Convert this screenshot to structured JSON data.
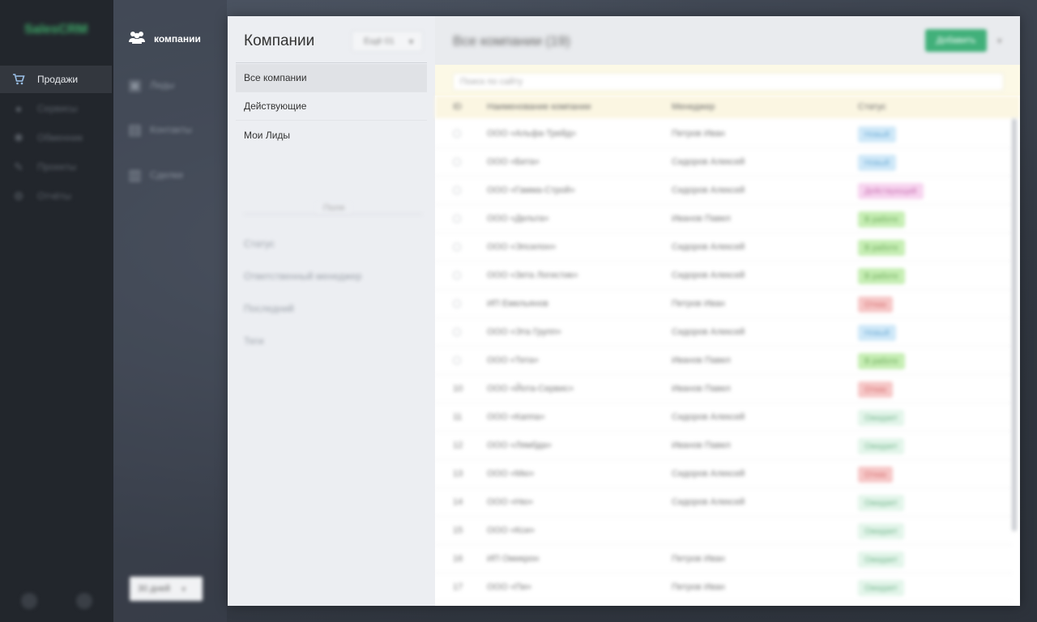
{
  "app": {
    "logo": "SalesCRM"
  },
  "main_nav": {
    "items": [
      {
        "label": "Продажи",
        "icon": "cart-icon",
        "active": true
      },
      {
        "label": "Сервисы",
        "icon": "plus-circle-icon",
        "active": false
      },
      {
        "label": "Обменник",
        "icon": "settings-icon",
        "active": false
      },
      {
        "label": "Проекты",
        "icon": "edit-icon",
        "active": false
      },
      {
        "label": "Отчёты",
        "icon": "gear-icon",
        "active": false
      }
    ]
  },
  "sub_nav": {
    "items": [
      {
        "label": "компании",
        "icon": "users-icon",
        "active": true
      },
      {
        "label": "Лиды",
        "icon": "card-icon",
        "active": false
      },
      {
        "label": "Контакты",
        "icon": "contact-icon",
        "active": false
      },
      {
        "label": "Сделки",
        "icon": "list-icon",
        "active": false
      }
    ],
    "period_select": "30 дней"
  },
  "filters": {
    "title": "Компании",
    "button_label": "Ещё 01",
    "items": [
      {
        "label": "Все компании",
        "active": true
      },
      {
        "label": "Действующие",
        "active": false
      },
      {
        "label": "Мои Лиды",
        "active": false
      }
    ],
    "separator_label": "Поля",
    "extra_items": [
      "Статус",
      "Ответственный менеджер",
      "Последний",
      "Теги"
    ]
  },
  "table": {
    "title": "Все компании (19)",
    "add_button": "Добавить",
    "search_placeholder": "Поиск по сайту",
    "columns": [
      "ID",
      "Наименование компании",
      "Менеджер",
      "Статус"
    ],
    "rows": [
      {
        "id": "",
        "name": "ООО «Альфа-Трейд»",
        "manager": "Петров Иван",
        "status": "Новый",
        "status_color": "#cfe8f8",
        "status_text": "#6aaad4"
      },
      {
        "id": "",
        "name": "ООО «Бета»",
        "manager": "Сидоров Алексей",
        "status": "Новый",
        "status_color": "#cfe8f8",
        "status_text": "#6aaad4"
      },
      {
        "id": "",
        "name": "ООО «Гамма-Строй»",
        "manager": "Сидоров Алексей",
        "status": "Действующий",
        "status_color": "#f7d4ef",
        "status_text": "#c76fb0"
      },
      {
        "id": "",
        "name": "ООО «Дельта»",
        "manager": "Иванов Павел",
        "status": "В работе",
        "status_color": "#c6eeb4",
        "status_text": "#6aa857"
      },
      {
        "id": "",
        "name": "ООО «Эпсилон»",
        "manager": "Сидоров Алексей",
        "status": "В работе",
        "status_color": "#c6eeb4",
        "status_text": "#6aa857"
      },
      {
        "id": "",
        "name": "ООО «Зета Логистик»",
        "manager": "Сидоров Алексей",
        "status": "В работе",
        "status_color": "#c6eeb4",
        "status_text": "#6aa857"
      },
      {
        "id": "",
        "name": "ИП Емельянов",
        "manager": "Петров Иван",
        "status": "Отказ",
        "status_color": "#f6c7c7",
        "status_text": "#d46a6a"
      },
      {
        "id": "",
        "name": "ООО «Эта Групп»",
        "manager": "Сидоров Алексей",
        "status": "Новый",
        "status_color": "#cfe8f8",
        "status_text": "#6aaad4"
      },
      {
        "id": "",
        "name": "ООО «Тета»",
        "manager": "Иванов Павел",
        "status": "В работе",
        "status_color": "#c6eeb4",
        "status_text": "#6aa857"
      },
      {
        "id": "10",
        "name": "ООО «Йота-Сервис»",
        "manager": "Иванов Павел",
        "status": "Отказ",
        "status_color": "#f6c7c7",
        "status_text": "#d46a6a"
      },
      {
        "id": "11",
        "name": "ООО «Каппа»",
        "manager": "Сидоров Алексей",
        "status": "Ожидает",
        "status_color": "#e3f5ea",
        "status_text": "#72b58c"
      },
      {
        "id": "12",
        "name": "ООО «Лямбда»",
        "manager": "Иванов Павел",
        "status": "Ожидает",
        "status_color": "#e3f5ea",
        "status_text": "#72b58c"
      },
      {
        "id": "13",
        "name": "ООО «Мю»",
        "manager": "Сидоров Алексей",
        "status": "Отказ",
        "status_color": "#f6c7c7",
        "status_text": "#d46a6a"
      },
      {
        "id": "14",
        "name": "ООО «Ню»",
        "manager": "Сидоров Алексей",
        "status": "Ожидает",
        "status_color": "#e3f5ea",
        "status_text": "#72b58c"
      },
      {
        "id": "15",
        "name": "ООО «Кси»",
        "manager": "",
        "status": "Ожидает",
        "status_color": "#e3f5ea",
        "status_text": "#72b58c"
      },
      {
        "id": "16",
        "name": "ИП Омикрон",
        "manager": "Петров Иван",
        "status": "Ожидает",
        "status_color": "#e3f5ea",
        "status_text": "#72b58c"
      },
      {
        "id": "17",
        "name": "ООО «Пи»",
        "manager": "Петров Иван",
        "status": "Ожидает",
        "status_color": "#e3f5ea",
        "status_text": "#72b58c"
      }
    ]
  }
}
